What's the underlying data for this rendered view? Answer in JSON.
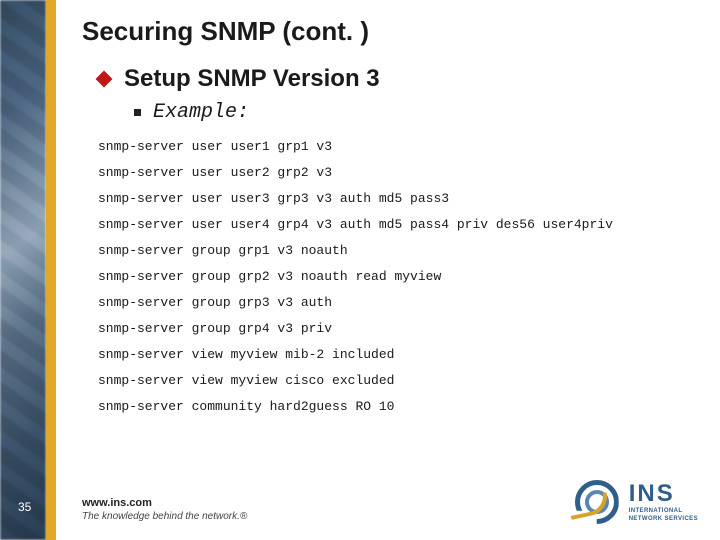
{
  "title": "Securing SNMP (cont. )",
  "bullet": "Setup SNMP Version 3",
  "sub_bullet": "Example:",
  "code_lines": [
    "snmp-server user user1 grp1 v3",
    "snmp-server user user2 grp2 v3",
    "snmp-server user user3 grp3 v3 auth md5 pass3",
    "snmp-server user user4 grp4 v3 auth md5 pass4 priv des56 user4priv",
    "snmp-server group grp1 v3 noauth",
    "snmp-server group grp2 v3 noauth read myview",
    "snmp-server group grp3 v3 auth",
    "snmp-server group grp4 v3 priv",
    "snmp-server view myview mib-2 included",
    "snmp-server view myview cisco excluded",
    "snmp-server community hard2guess RO 10"
  ],
  "footer": {
    "url": "www.ins.com",
    "tagline": "The knowledge behind the network.®"
  },
  "page_number": "35",
  "logo": {
    "abbrev": "INS",
    "line1": "INTERNATIONAL",
    "line2": "NETWORK SERVICES"
  }
}
